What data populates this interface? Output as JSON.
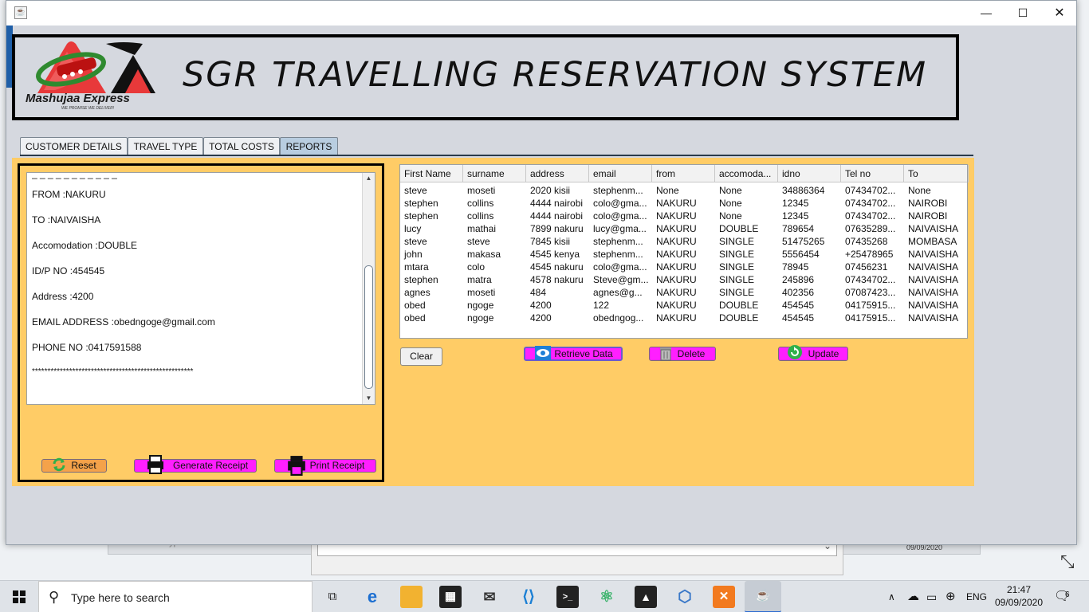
{
  "background": {
    "search_ghost": "Type here to search",
    "date": "09/09/2020"
  },
  "window": {
    "title_icon": "java-icon",
    "header_title": "SGR TRAVELLING RESERVATION SYSTEM",
    "logo_text": "Mashujaa Express",
    "logo_tagline": "WE PROMISE WE DELIVER!"
  },
  "tabs": [
    {
      "label": "CUSTOMER DETAILS"
    },
    {
      "label": "TRAVEL TYPE"
    },
    {
      "label": "TOTAL COSTS"
    },
    {
      "label": "REPORTS"
    }
  ],
  "receipt": {
    "lines": [
      "FROM :NAKURU",
      "TO :NAIVAISHA",
      "Accomodation :DOUBLE",
      "ID/P NO :454545",
      "Address :4200",
      "EMAIL ADDRESS :obedngoge@gmail.com",
      "PHONE NO :0417591588",
      "****************************************************"
    ],
    "reset_label": "Reset",
    "generate_label": "Generate Receipt",
    "print_label": "Print Receipt"
  },
  "table": {
    "columns": [
      "First Name",
      "surname",
      "address",
      "email",
      "from",
      "accomoda...",
      "idno",
      "Tel no",
      "To"
    ],
    "rows": [
      [
        "steve",
        "moseti",
        "2020 kisii",
        "stephenm...",
        "None",
        "None",
        "34886364",
        "07434702...",
        "None"
      ],
      [
        "stephen",
        "collins",
        "4444 nairobi",
        "colo@gma...",
        "NAKURU",
        "None",
        "12345",
        "07434702...",
        "NAIROBI"
      ],
      [
        "stephen",
        "collins",
        "4444 nairobi",
        "colo@gma...",
        "NAKURU",
        "None",
        "12345",
        "07434702...",
        "NAIROBI"
      ],
      [
        "lucy",
        "mathai",
        "7899 nakuru",
        "lucy@gma...",
        "NAKURU",
        "DOUBLE",
        "789654",
        "07635289...",
        "NAIVAISHA"
      ],
      [
        "steve",
        "steve",
        "7845 kisii",
        "stephenm...",
        "NAKURU",
        "SINGLE",
        "51475265",
        "07435268",
        "MOMBASA"
      ],
      [
        "john",
        "makasa",
        "4545 kenya",
        "stephenm...",
        "NAKURU",
        "SINGLE",
        "5556454",
        "+25478965",
        "NAIVAISHA"
      ],
      [
        "mtara",
        "colo",
        "4545 nakuru",
        "colo@gma...",
        "NAKURU",
        "SINGLE",
        "78945",
        "07456231",
        "NAIVAISHA"
      ],
      [
        "stephen",
        "matra",
        "4578 nakuru",
        "Steve@gm...",
        "NAKURU",
        "SINGLE",
        "245896",
        "07434702...",
        "NAIVAISHA"
      ],
      [
        "agnes",
        "moseti",
        "484",
        "agnes@g...",
        "NAKURU",
        "SINGLE",
        "402356",
        "07087423...",
        "NAIVAISHA"
      ],
      [
        "obed",
        "ngoge",
        "4200",
        "122",
        "NAKURU",
        "DOUBLE",
        "454545",
        "04175915...",
        "NAIVAISHA"
      ],
      [
        "obed",
        "ngoge",
        "4200",
        "obedngog...",
        "NAKURU",
        "DOUBLE",
        "454545",
        "04175915...",
        "NAIVAISHA"
      ]
    ]
  },
  "actions": {
    "clear_label": "Clear",
    "retrieve_label": "Retrieve Data",
    "delete_label": "Delete",
    "update_label": "Update"
  },
  "taskbar": {
    "search_placeholder": "Type here to search",
    "language": "ENG",
    "time": "21:47",
    "date": "09/09/2020",
    "notification_count": "6"
  }
}
